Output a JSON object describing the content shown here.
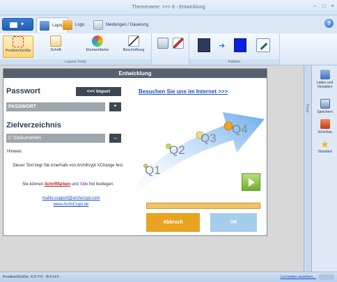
{
  "window": {
    "title": "Themename: >>> 8 - Entwicklung",
    "controls": [
      "–",
      "□",
      "×"
    ]
  },
  "ribbon": {
    "tabs": [
      {
        "label": "Layout",
        "icon": "layout-icon",
        "active": true
      },
      {
        "label": "Logo",
        "icon": "logo-icon",
        "active": false
      },
      {
        "label": "Meldungen / Dauerung",
        "icon": "messages-icon",
        "active": false
      }
    ],
    "help": "?",
    "groups": {
      "layout_tools": {
        "label": "Layout Tools",
        "buttons": [
          {
            "label": "Position/Größe",
            "icon": "position-size-icon",
            "selected": true
          },
          {
            "label": "Schrift",
            "icon": "font-icon",
            "selected": false
          },
          {
            "label": "Elementfarbe",
            "icon": "element-color-icon",
            "selected": false
          },
          {
            "label": "Beschriftung",
            "icon": "label-icon",
            "selected": false
          }
        ]
      },
      "farben": {
        "label": "Farben",
        "colors": {
          "from": "#2d3a58",
          "to": "#0a20e8"
        }
      }
    }
  },
  "dialog": {
    "title": "Entwicklung",
    "password_label": "Passwort",
    "import_button": "<<< Import",
    "password_value": "PASSWORT",
    "password_reveal": "*",
    "directory_label": "Zielverzeichnis",
    "directory_value": "C:\\Dokumente\\",
    "browse_button": "...",
    "hint_label": "Hinweis",
    "hint_line1": "Dieser Text liegt Sie innerhalb von ArchiKrypt XChange fest.",
    "hint_line2a": "Sie können ",
    "hint_line2b": "Schriftfarben",
    "hint_line2c": " und ",
    "hint_line2d": "Stile",
    "hint_line2e": " frei festlegen.",
    "mail_link": "mailto:support@archicrypt.com",
    "web_link": "www.ArchiCrypt.de",
    "internet_link": "Besuchen Sie uns im Internet >>>",
    "quarters": [
      "Q1",
      "Q2",
      "Q3",
      "Q4"
    ],
    "progress_percent": 100,
    "cancel_button": "Abbruch",
    "ok_button": "OK"
  },
  "right_panel": {
    "strip_label": "Trenz",
    "items": [
      {
        "label": "Laden und Verwalten",
        "icon": "folder-open-icon"
      },
      {
        "label": "Speichern",
        "icon": "save-icon"
      },
      {
        "label": "Vorschau",
        "icon": "preview-icon"
      },
      {
        "label": "Standard",
        "icon": "star-icon"
      }
    ]
  },
  "statusbar": {
    "text": "Position/Größe: X:0 Y:0 - B:0 H:0",
    "link": "Lernvideo ansehen..."
  }
}
